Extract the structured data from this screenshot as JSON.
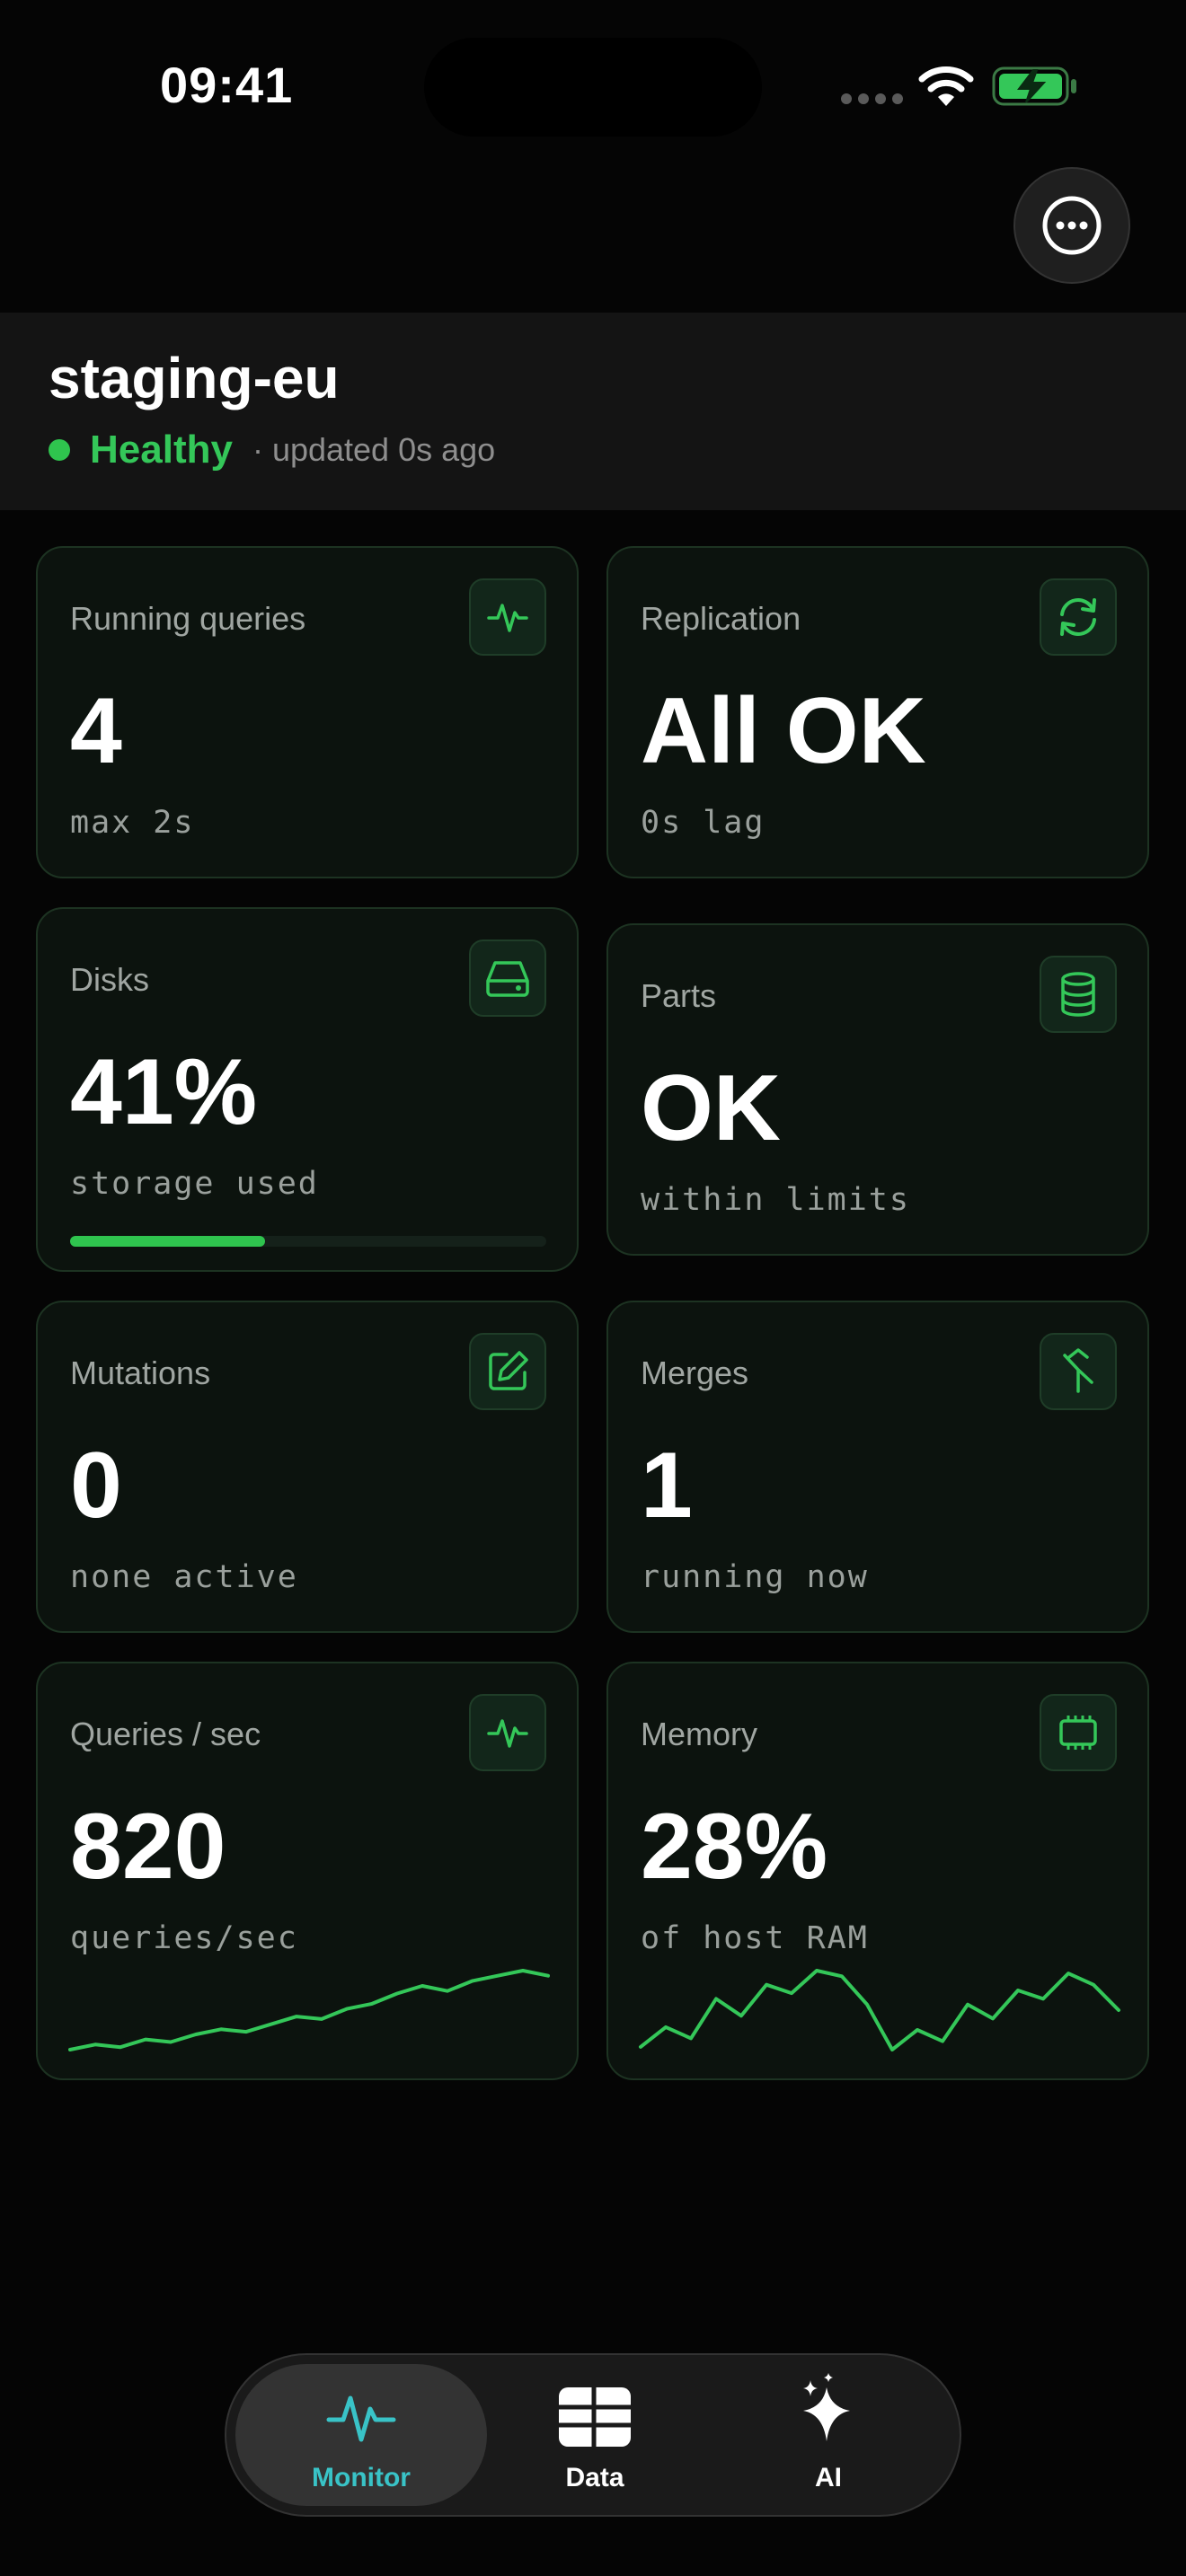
{
  "status_bar": {
    "time": "09:41"
  },
  "header": {
    "cluster_name": "staging-eu",
    "health": "Healthy",
    "updated": "· updated 0s ago"
  },
  "cards": [
    {
      "title": "Running queries",
      "value": "4",
      "sub": "max 2s",
      "icon": "activity-icon"
    },
    {
      "title": "Replication",
      "value": "All OK",
      "sub": "0s lag",
      "icon": "sync-icon"
    },
    {
      "title": "Disks",
      "value": "41%",
      "sub": "storage used",
      "icon": "hard-drive-icon",
      "progress": 0.41
    },
    {
      "title": "Parts",
      "value": "OK",
      "sub": "within limits",
      "icon": "database-icon"
    },
    {
      "title": "Mutations",
      "value": "0",
      "sub": "none active",
      "icon": "edit-icon"
    },
    {
      "title": "Merges",
      "value": "1",
      "sub": "running now",
      "icon": "merge-icon"
    },
    {
      "title": "Queries / sec",
      "value": "820",
      "sub": "queries/sec",
      "icon": "activity-icon",
      "sparkline": [
        2,
        4,
        3,
        6,
        5,
        8,
        10,
        9,
        12,
        15,
        14,
        18,
        20,
        24,
        27,
        25,
        29,
        31,
        33,
        31
      ]
    },
    {
      "title": "Memory",
      "value": "28%",
      "sub": "of host RAM",
      "icon": "chip-icon",
      "sparkline": [
        5,
        12,
        8,
        22,
        16,
        27,
        24,
        32,
        30,
        20,
        4,
        11,
        7,
        20,
        15,
        25,
        22,
        31,
        27,
        18
      ]
    }
  ],
  "tabs": [
    {
      "label": "Monitor",
      "icon": "pulse-icon",
      "active": true
    },
    {
      "label": "Data",
      "icon": "table-icon",
      "active": false
    },
    {
      "label": "AI",
      "icon": "sparkles-icon",
      "active": false
    }
  ],
  "colors": {
    "accent_green": "#34c759",
    "accent_teal": "#39c3c7",
    "card_bg": "#0c130e"
  }
}
